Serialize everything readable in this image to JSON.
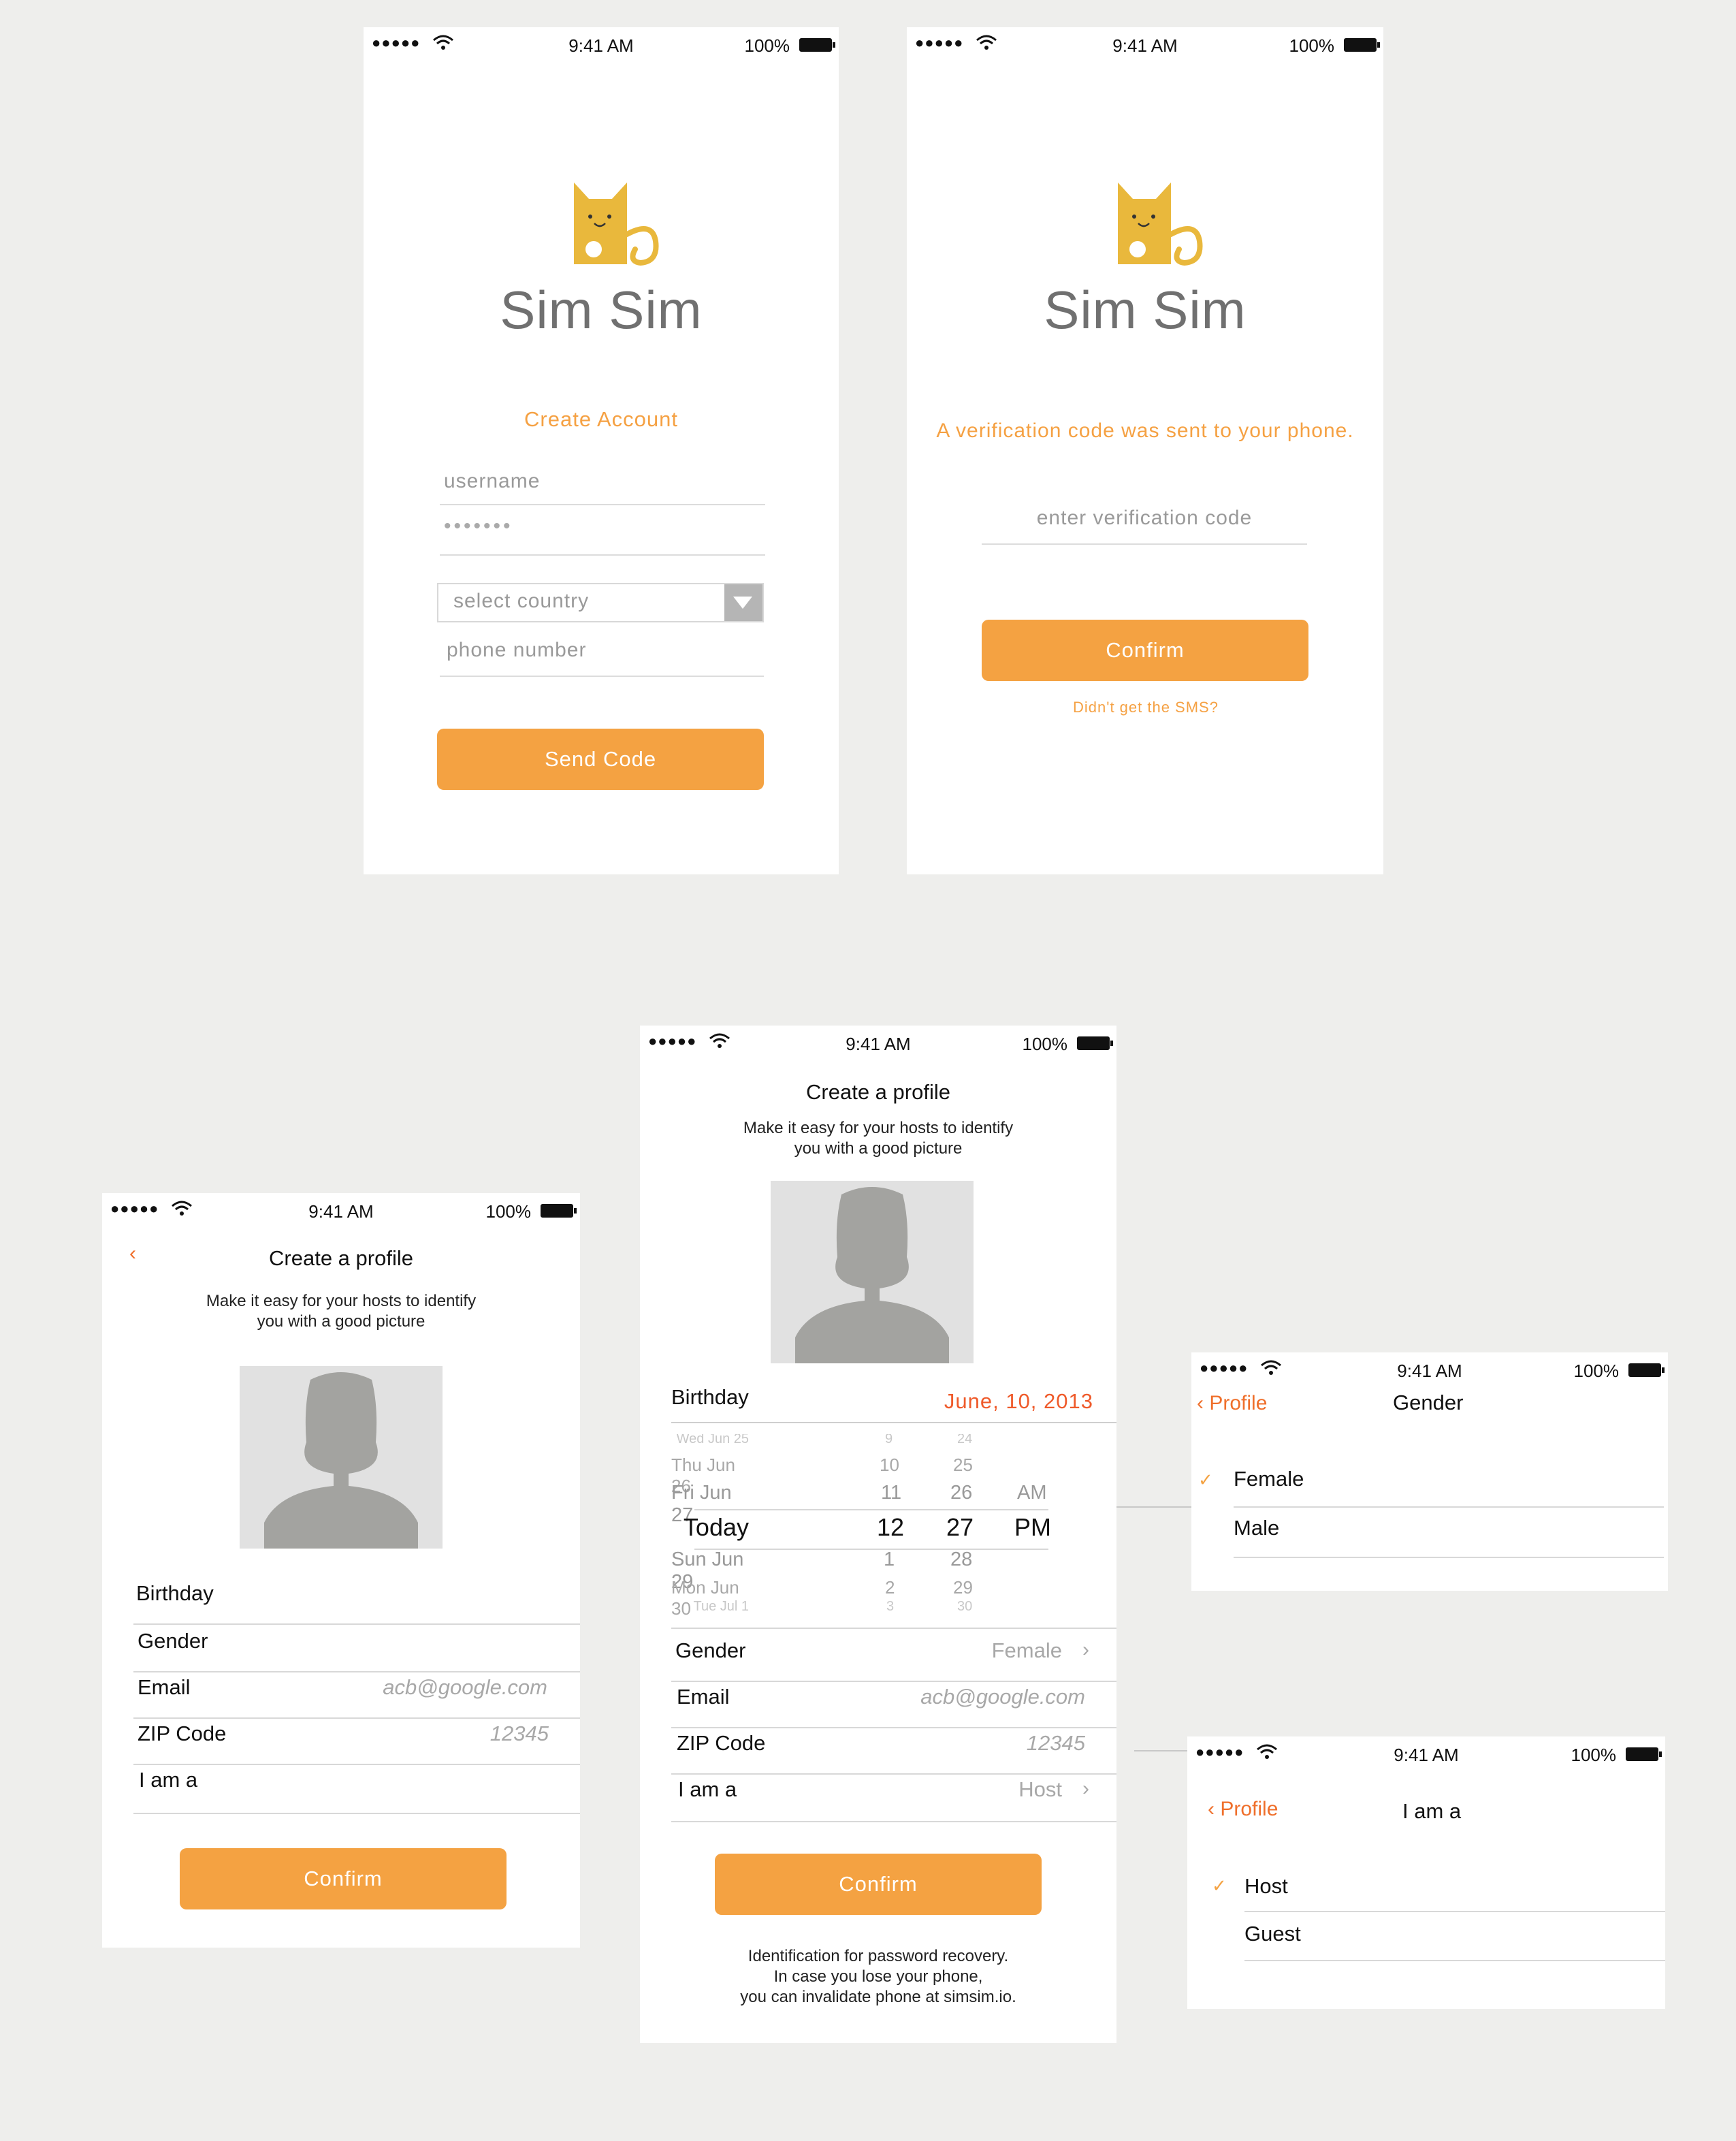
{
  "status": {
    "time": "9:41 AM",
    "battery": "100%"
  },
  "colors": {
    "accent": "#f4a242",
    "accent_text": "#f5a143",
    "back_link": "#ef6f2b",
    "logo_cat": "#e9b83c"
  },
  "brand": {
    "name": "Sim Sim"
  },
  "screen1": {
    "heading": "Create Account",
    "username_placeholder": "username",
    "password_mask": "•••••••",
    "country_placeholder": "select country",
    "phone_placeholder": "phone number",
    "button": "Send Code"
  },
  "screen2": {
    "message": "A verification code was sent to your phone.",
    "code_placeholder": "enter verification code",
    "button": "Confirm",
    "resend_link": "Didn't get the SMS?"
  },
  "profile_left": {
    "title": "Create a profile",
    "subtitle_1": "Make it easy for your hosts to identify",
    "subtitle_2": "you with a good picture",
    "rows": {
      "birthday": "Birthday",
      "gender": "Gender",
      "email": "Email",
      "email_value": "acb@google.com",
      "zip": "ZIP Code",
      "zip_value": "12345",
      "iam": "I am a"
    },
    "button": "Confirm"
  },
  "profile_center": {
    "title": "Create a profile",
    "subtitle_1": "Make it easy for your hosts to identify",
    "subtitle_2": "you with a good picture",
    "birthday_label": "Birthday",
    "birthday_value": "June, 10, 2013",
    "picker": {
      "rows": [
        {
          "day": "Wed Jun 25",
          "hour": "9",
          "min": "24",
          "ampm": ""
        },
        {
          "day": "Thu Jun 26",
          "hour": "10",
          "min": "25",
          "ampm": ""
        },
        {
          "day": "Fri Jun 27",
          "hour": "11",
          "min": "26",
          "ampm": "AM"
        },
        {
          "day": "Today",
          "hour": "12",
          "min": "27",
          "ampm": "PM"
        },
        {
          "day": "Sun Jun 29",
          "hour": "1",
          "min": "28",
          "ampm": ""
        },
        {
          "day": "Mon Jun 30",
          "hour": "2",
          "min": "29",
          "ampm": ""
        },
        {
          "day": "Tue Jul 1",
          "hour": "3",
          "min": "30",
          "ampm": ""
        }
      ]
    },
    "rows": {
      "gender": "Gender",
      "gender_value": "Female",
      "email": "Email",
      "email_value": "acb@google.com",
      "zip": "ZIP Code",
      "zip_value": "12345",
      "iam": "I am a",
      "iam_value": "Host"
    },
    "button": "Confirm",
    "footer_1": "Identification for password recovery.",
    "footer_2": "In case you lose your phone,",
    "footer_3": "you can invalidate phone at simsim.io."
  },
  "gender_screen": {
    "back": "Profile",
    "title": "Gender",
    "options": [
      "Female",
      "Male"
    ],
    "selected": "Female"
  },
  "iam_screen": {
    "back": "Profile",
    "title": "I am a",
    "options": [
      "Host",
      "Guest"
    ],
    "selected": "Host"
  }
}
